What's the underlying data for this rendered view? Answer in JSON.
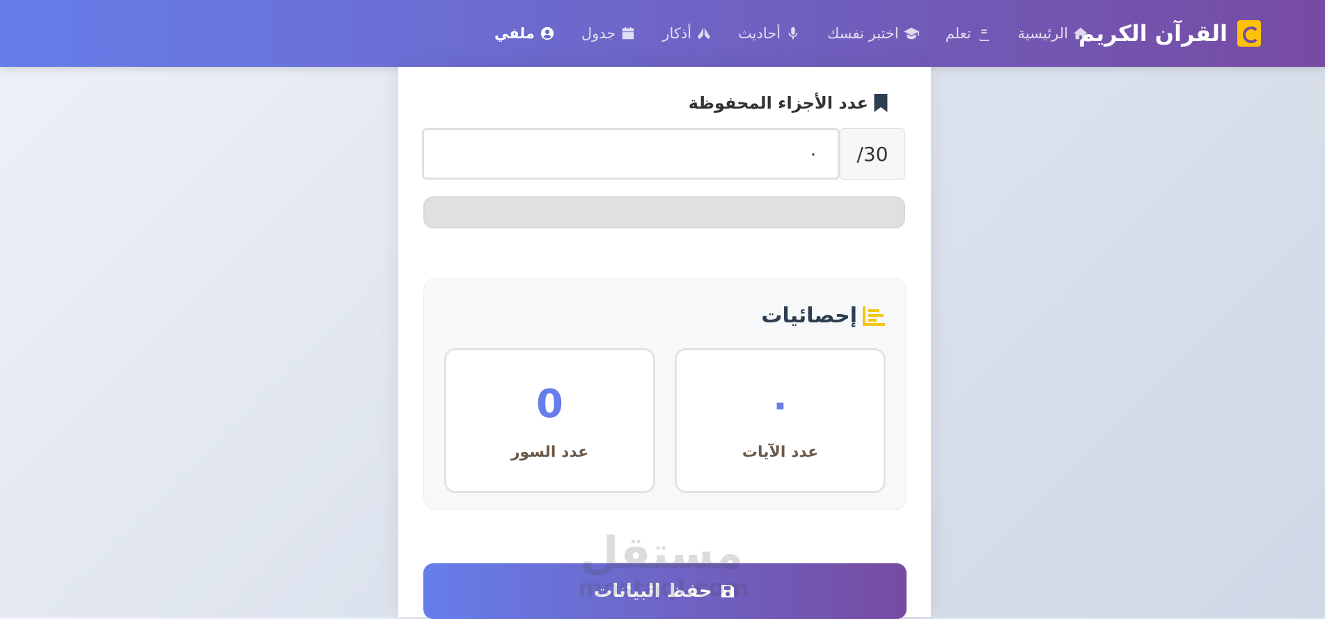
{
  "navbar": {
    "brand": "القرآن الكريم",
    "links": [
      {
        "label": "الرئيسية",
        "icon": "home-icon"
      },
      {
        "label": "تعلم",
        "icon": "book-icon"
      },
      {
        "label": "اختبر نفسك",
        "icon": "graduation-cap-icon"
      },
      {
        "label": "أحاديث",
        "icon": "microphone-icon"
      },
      {
        "label": "أذكار",
        "icon": "praying-hands-icon"
      },
      {
        "label": "جدول",
        "icon": "calendar-icon"
      },
      {
        "label": "ملفي",
        "icon": "user-circle-icon"
      }
    ],
    "active_link": "ملفي"
  },
  "form": {
    "juz_label": "عدد الأجزاء المحفوظة",
    "juz_value": "٠",
    "juz_suffix": "30/",
    "progress": 0
  },
  "stats": {
    "title": "إحصائيات",
    "ayat_value": "٠",
    "ayat_label": "عدد الآيات",
    "surah_value": "0",
    "surah_label": "عدد السور"
  },
  "save_button": {
    "label": "حفظ البيانات"
  },
  "watermark": {
    "ar": "مستقل",
    "en": "mostaql.com"
  },
  "colors": {
    "gradient_start": "#667eea",
    "gradient_end": "#764ba2",
    "brand_accent": "#ffc107",
    "stat_value": "#667eea"
  }
}
